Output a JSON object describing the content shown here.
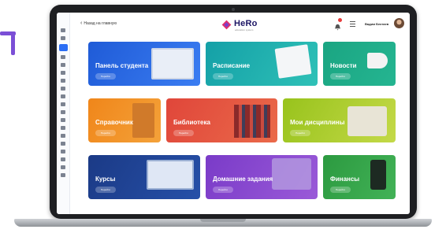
{
  "app": {
    "name": "HeRo",
    "tagline": "education system"
  },
  "topbar": {
    "back_label": "Назад на главную",
    "user_name": "Вадим Бектаев"
  },
  "tiles": [
    {
      "label": "Панель студента",
      "button": "Перейти",
      "color": "#1f5bd7"
    },
    {
      "label": "Расписание",
      "button": "Перейти",
      "color": "#1aa6a6"
    },
    {
      "label": "Новости",
      "button": "Перейти",
      "color": "#20a587"
    },
    {
      "label": "Справочник",
      "button": "Перейти",
      "color": "#f08a18"
    },
    {
      "label": "Библиотека",
      "button": "Перейти",
      "color": "#e24a3c"
    },
    {
      "label": "Мои дисциплины",
      "button": "Перейти",
      "color": "#9bc61f"
    },
    {
      "label": "Курсы",
      "button": "Перейти",
      "color": "#1c3f8f"
    },
    {
      "label": "Домашние задания",
      "button": "Перейти",
      "color": "#7a3fc9"
    },
    {
      "label": "Финансы",
      "button": "Перейти",
      "color": "#2e9d43"
    }
  ]
}
